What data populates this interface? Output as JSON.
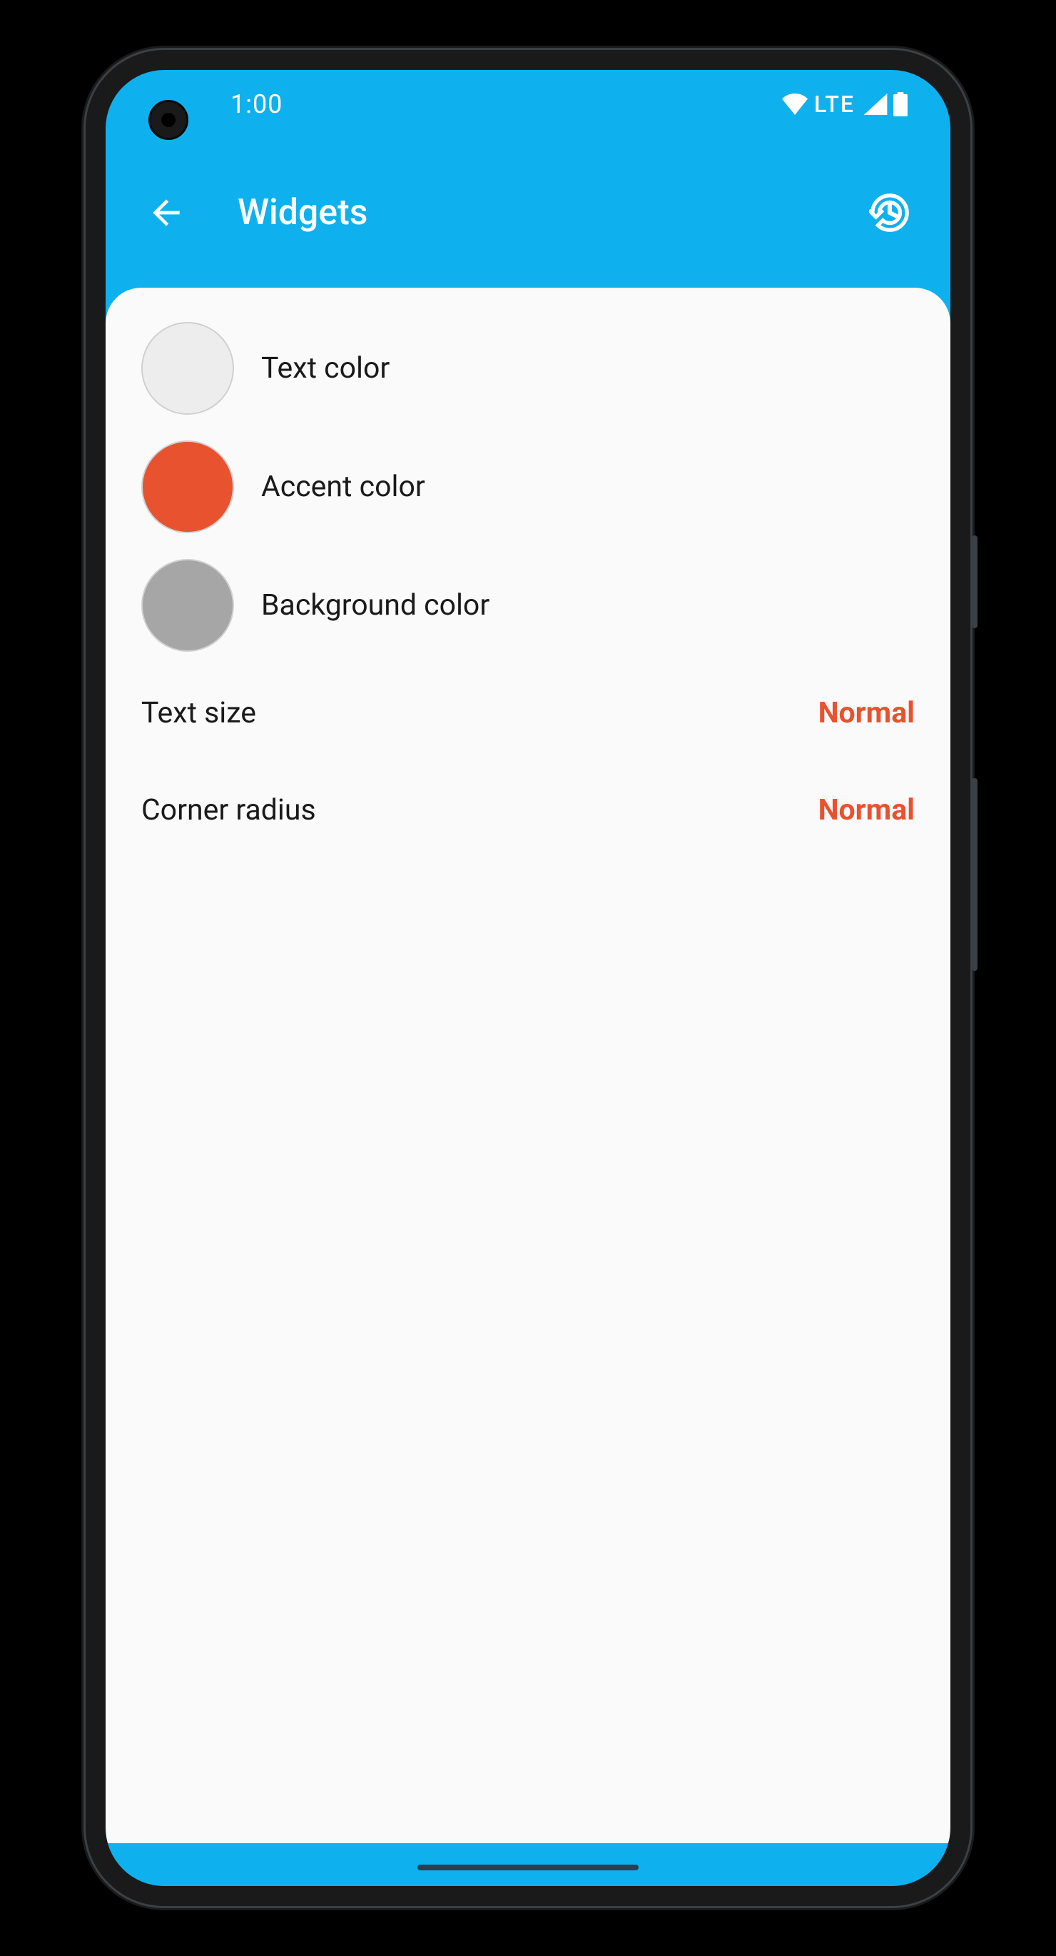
{
  "status_bar": {
    "time": "1:00",
    "network_label": "LTE"
  },
  "app_bar": {
    "title": "Widgets"
  },
  "settings": {
    "colors": [
      {
        "label": "Text color",
        "swatch": "#ededed"
      },
      {
        "label": "Accent color",
        "swatch": "#e8522f"
      },
      {
        "label": "Background color",
        "swatch": "#a6a6a6"
      }
    ],
    "options": [
      {
        "label": "Text size",
        "value": "Normal"
      },
      {
        "label": "Corner radius",
        "value": "Normal"
      }
    ]
  },
  "colors": {
    "accent": "#e8522f",
    "primary": "#0eb1ed",
    "background": "#fafafa"
  }
}
